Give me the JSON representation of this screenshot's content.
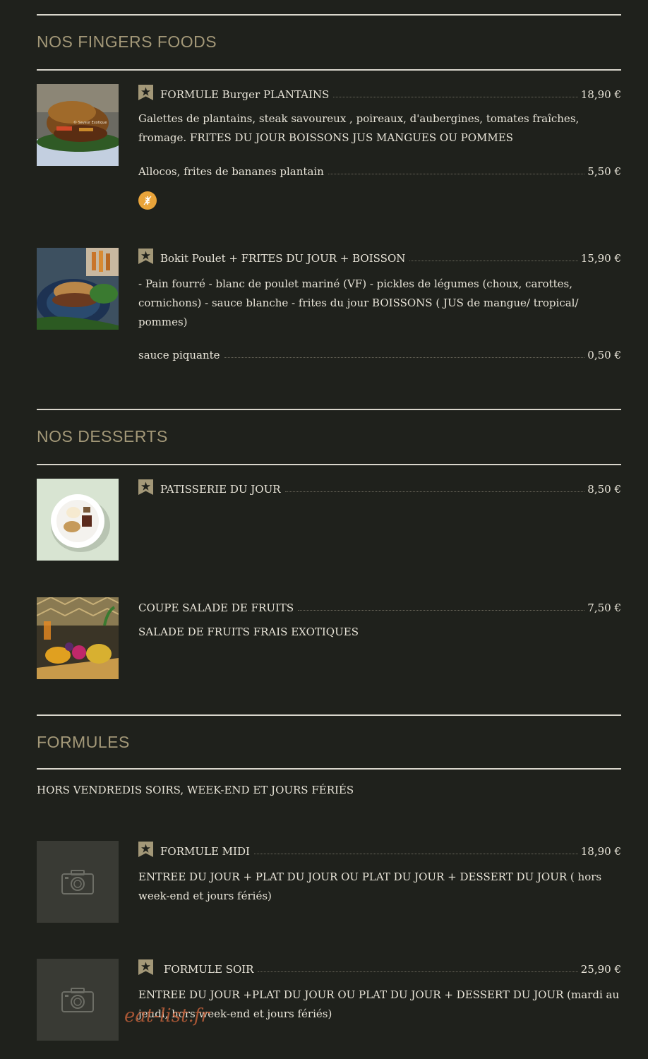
{
  "sections": {
    "fingers": {
      "title": "NOS FINGERS FOODS",
      "items": [
        {
          "name": "FORMULE Burger PLANTAINS",
          "price": "18,90 €",
          "desc": "Galettes de plantains, steak savoureux , poireaux, d'aubergines, tomates fraîches, fromage. FRITES DU JOUR BOISSONS JUS MANGUES OU POMMES",
          "option": {
            "name": "Allocos, frites de bananes plantain",
            "price": "5,50 €"
          },
          "image_icon": "burger-photo",
          "thumb_label": "© Saveur Exotique"
        },
        {
          "name": "Bokit Poulet + FRITES DU JOUR + BOISSON",
          "price": "15,90 €",
          "desc": "- Pain fourré - blanc de poulet mariné (VF) - pickles de légumes (choux, carottes, cornichons) - sauce blanche - frites du jour BOISSONS ( JUS de mangue/ tropical/ pommes)",
          "option": {
            "name": "sauce piquante",
            "price": "0,50 €"
          },
          "image_icon": "bokit-photo"
        }
      ]
    },
    "desserts": {
      "title": "NOS DESSERTS",
      "items": [
        {
          "name": "PATISSERIE DU JOUR",
          "price": "8,50 €",
          "image_icon": "pastry-photo"
        },
        {
          "name": "COUPE SALADE DE FRUITS",
          "price": "7,50 €",
          "desc": "SALADE DE FRUITS FRAIS EXOTIQUES",
          "image_icon": "fruit-salad-photo"
        }
      ]
    },
    "formules": {
      "title": "FORMULES",
      "note": "HORS VENDREDIS SOIRS, WEEK-END ET JOURS FÉRIÉS",
      "items": [
        {
          "name": "FORMULE MIDI",
          "price": "18,90 €",
          "desc": "ENTREE DU JOUR + PLAT DU JOUR OU PLAT DU JOUR + DESSERT DU JOUR ( hors week-end et jours fériés)",
          "image_icon": "camera-icon"
        },
        {
          "name": "FORMULE SOIR",
          "price": "25,90 €",
          "desc": "ENTREE DU JOUR +PLAT DU JOUR OU PLAT DU JOUR + DESSERT DU JOUR (mardi au jeudi, hors week-end et jours fériés)",
          "image_icon": "camera-icon"
        }
      ]
    }
  },
  "watermark": "eat-list.fr",
  "colors": {
    "background": "#1f211c",
    "heading": "#a39878",
    "text": "#e8e4d8",
    "badge": "#e9a43a",
    "star": "#a39878"
  }
}
